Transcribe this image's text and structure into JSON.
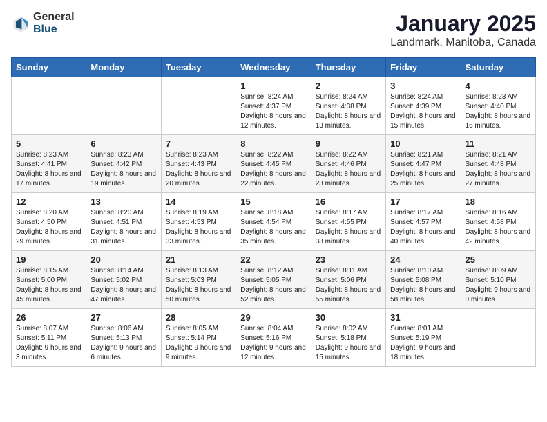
{
  "header": {
    "logo_general": "General",
    "logo_blue": "Blue",
    "month": "January 2025",
    "location": "Landmark, Manitoba, Canada"
  },
  "days_of_week": [
    "Sunday",
    "Monday",
    "Tuesday",
    "Wednesday",
    "Thursday",
    "Friday",
    "Saturday"
  ],
  "weeks": [
    [
      {
        "day": "",
        "sunrise": "",
        "sunset": "",
        "daylight": ""
      },
      {
        "day": "",
        "sunrise": "",
        "sunset": "",
        "daylight": ""
      },
      {
        "day": "",
        "sunrise": "",
        "sunset": "",
        "daylight": ""
      },
      {
        "day": "1",
        "sunrise": "Sunrise: 8:24 AM",
        "sunset": "Sunset: 4:37 PM",
        "daylight": "Daylight: 8 hours and 12 minutes."
      },
      {
        "day": "2",
        "sunrise": "Sunrise: 8:24 AM",
        "sunset": "Sunset: 4:38 PM",
        "daylight": "Daylight: 8 hours and 13 minutes."
      },
      {
        "day": "3",
        "sunrise": "Sunrise: 8:24 AM",
        "sunset": "Sunset: 4:39 PM",
        "daylight": "Daylight: 8 hours and 15 minutes."
      },
      {
        "day": "4",
        "sunrise": "Sunrise: 8:23 AM",
        "sunset": "Sunset: 4:40 PM",
        "daylight": "Daylight: 8 hours and 16 minutes."
      }
    ],
    [
      {
        "day": "5",
        "sunrise": "Sunrise: 8:23 AM",
        "sunset": "Sunset: 4:41 PM",
        "daylight": "Daylight: 8 hours and 17 minutes."
      },
      {
        "day": "6",
        "sunrise": "Sunrise: 8:23 AM",
        "sunset": "Sunset: 4:42 PM",
        "daylight": "Daylight: 8 hours and 19 minutes."
      },
      {
        "day": "7",
        "sunrise": "Sunrise: 8:23 AM",
        "sunset": "Sunset: 4:43 PM",
        "daylight": "Daylight: 8 hours and 20 minutes."
      },
      {
        "day": "8",
        "sunrise": "Sunrise: 8:22 AM",
        "sunset": "Sunset: 4:45 PM",
        "daylight": "Daylight: 8 hours and 22 minutes."
      },
      {
        "day": "9",
        "sunrise": "Sunrise: 8:22 AM",
        "sunset": "Sunset: 4:46 PM",
        "daylight": "Daylight: 8 hours and 23 minutes."
      },
      {
        "day": "10",
        "sunrise": "Sunrise: 8:21 AM",
        "sunset": "Sunset: 4:47 PM",
        "daylight": "Daylight: 8 hours and 25 minutes."
      },
      {
        "day": "11",
        "sunrise": "Sunrise: 8:21 AM",
        "sunset": "Sunset: 4:48 PM",
        "daylight": "Daylight: 8 hours and 27 minutes."
      }
    ],
    [
      {
        "day": "12",
        "sunrise": "Sunrise: 8:20 AM",
        "sunset": "Sunset: 4:50 PM",
        "daylight": "Daylight: 8 hours and 29 minutes."
      },
      {
        "day": "13",
        "sunrise": "Sunrise: 8:20 AM",
        "sunset": "Sunset: 4:51 PM",
        "daylight": "Daylight: 8 hours and 31 minutes."
      },
      {
        "day": "14",
        "sunrise": "Sunrise: 8:19 AM",
        "sunset": "Sunset: 4:53 PM",
        "daylight": "Daylight: 8 hours and 33 minutes."
      },
      {
        "day": "15",
        "sunrise": "Sunrise: 8:18 AM",
        "sunset": "Sunset: 4:54 PM",
        "daylight": "Daylight: 8 hours and 35 minutes."
      },
      {
        "day": "16",
        "sunrise": "Sunrise: 8:17 AM",
        "sunset": "Sunset: 4:55 PM",
        "daylight": "Daylight: 8 hours and 38 minutes."
      },
      {
        "day": "17",
        "sunrise": "Sunrise: 8:17 AM",
        "sunset": "Sunset: 4:57 PM",
        "daylight": "Daylight: 8 hours and 40 minutes."
      },
      {
        "day": "18",
        "sunrise": "Sunrise: 8:16 AM",
        "sunset": "Sunset: 4:58 PM",
        "daylight": "Daylight: 8 hours and 42 minutes."
      }
    ],
    [
      {
        "day": "19",
        "sunrise": "Sunrise: 8:15 AM",
        "sunset": "Sunset: 5:00 PM",
        "daylight": "Daylight: 8 hours and 45 minutes."
      },
      {
        "day": "20",
        "sunrise": "Sunrise: 8:14 AM",
        "sunset": "Sunset: 5:02 PM",
        "daylight": "Daylight: 8 hours and 47 minutes."
      },
      {
        "day": "21",
        "sunrise": "Sunrise: 8:13 AM",
        "sunset": "Sunset: 5:03 PM",
        "daylight": "Daylight: 8 hours and 50 minutes."
      },
      {
        "day": "22",
        "sunrise": "Sunrise: 8:12 AM",
        "sunset": "Sunset: 5:05 PM",
        "daylight": "Daylight: 8 hours and 52 minutes."
      },
      {
        "day": "23",
        "sunrise": "Sunrise: 8:11 AM",
        "sunset": "Sunset: 5:06 PM",
        "daylight": "Daylight: 8 hours and 55 minutes."
      },
      {
        "day": "24",
        "sunrise": "Sunrise: 8:10 AM",
        "sunset": "Sunset: 5:08 PM",
        "daylight": "Daylight: 8 hours and 58 minutes."
      },
      {
        "day": "25",
        "sunrise": "Sunrise: 8:09 AM",
        "sunset": "Sunset: 5:10 PM",
        "daylight": "Daylight: 9 hours and 0 minutes."
      }
    ],
    [
      {
        "day": "26",
        "sunrise": "Sunrise: 8:07 AM",
        "sunset": "Sunset: 5:11 PM",
        "daylight": "Daylight: 9 hours and 3 minutes."
      },
      {
        "day": "27",
        "sunrise": "Sunrise: 8:06 AM",
        "sunset": "Sunset: 5:13 PM",
        "daylight": "Daylight: 9 hours and 6 minutes."
      },
      {
        "day": "28",
        "sunrise": "Sunrise: 8:05 AM",
        "sunset": "Sunset: 5:14 PM",
        "daylight": "Daylight: 9 hours and 9 minutes."
      },
      {
        "day": "29",
        "sunrise": "Sunrise: 8:04 AM",
        "sunset": "Sunset: 5:16 PM",
        "daylight": "Daylight: 9 hours and 12 minutes."
      },
      {
        "day": "30",
        "sunrise": "Sunrise: 8:02 AM",
        "sunset": "Sunset: 5:18 PM",
        "daylight": "Daylight: 9 hours and 15 minutes."
      },
      {
        "day": "31",
        "sunrise": "Sunrise: 8:01 AM",
        "sunset": "Sunset: 5:19 PM",
        "daylight": "Daylight: 9 hours and 18 minutes."
      },
      {
        "day": "",
        "sunrise": "",
        "sunset": "",
        "daylight": ""
      }
    ]
  ]
}
